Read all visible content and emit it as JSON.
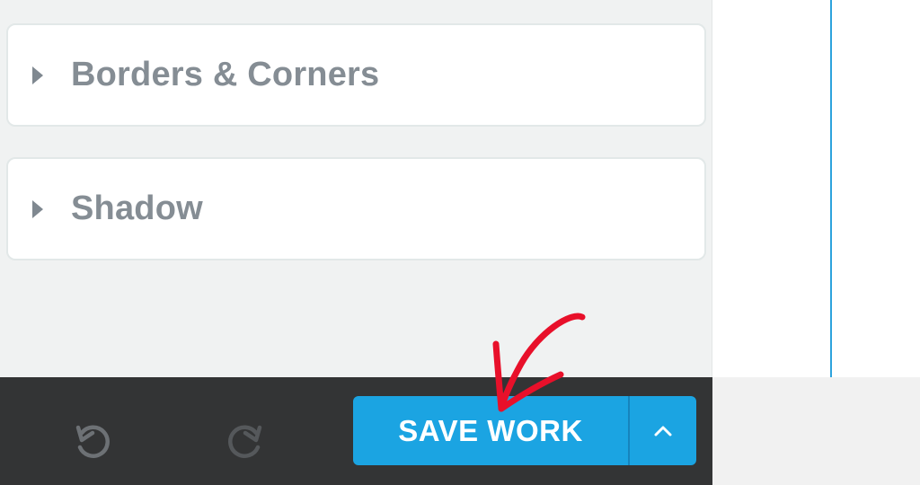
{
  "panels": [
    {
      "title": "Borders & Corners"
    },
    {
      "title": "Shadow"
    }
  ],
  "toolbar": {
    "undo_icon": "undo-icon",
    "redo_icon": "redo-icon",
    "save_label": "SAVE WORK",
    "more_icon": "chevron-up-icon"
  },
  "colors": {
    "accent": "#1ba4e2",
    "toolbar_bg": "#333435",
    "panel_text": "#858d94",
    "annotation": "#e8102a"
  }
}
